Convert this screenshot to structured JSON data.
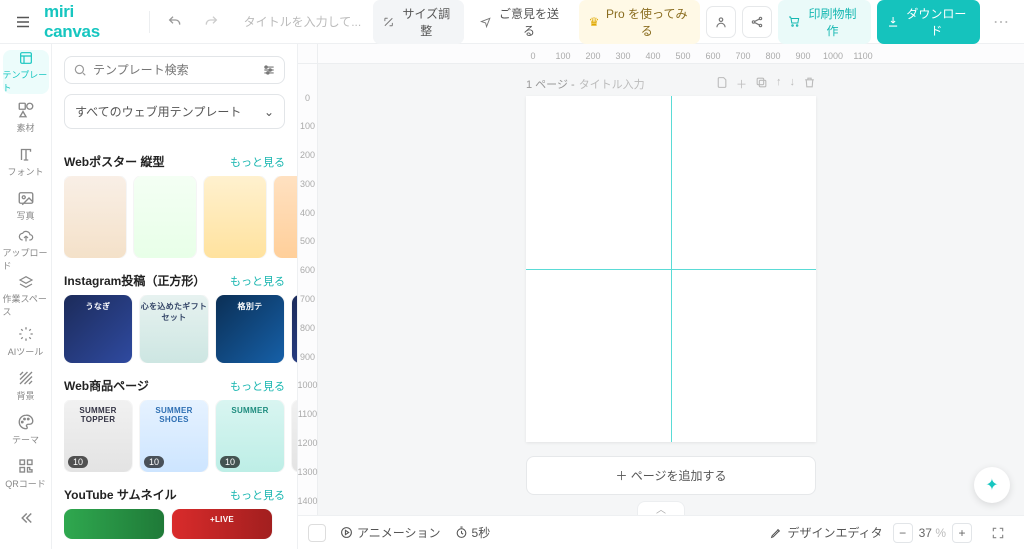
{
  "brand": {
    "name": "miri canvas"
  },
  "top": {
    "title_placeholder": "タイトルを入力して...",
    "resize": "サイズ調整",
    "feedback": "ご意見を送る",
    "pro": "Pro を使ってみる",
    "print": "印刷物制作",
    "download": "ダウンロード"
  },
  "sidenav": {
    "items": [
      {
        "key": "template",
        "label": "テンプレート"
      },
      {
        "key": "elements",
        "label": "素材"
      },
      {
        "key": "font",
        "label": "フォント"
      },
      {
        "key": "photo",
        "label": "写真"
      },
      {
        "key": "upload",
        "label": "アップロード"
      },
      {
        "key": "workspace",
        "label": "作業スペース"
      },
      {
        "key": "ai",
        "label": "AIツール"
      },
      {
        "key": "bg",
        "label": "背景"
      },
      {
        "key": "theme",
        "label": "テーマ"
      },
      {
        "key": "qr",
        "label": "QRコード"
      }
    ]
  },
  "panel": {
    "search_placeholder": "テンプレート検索",
    "filter_label": "すべてのウェブ用テンプレート",
    "more_label": "もっと見る",
    "sections": [
      {
        "title": "Webポスター 縦型"
      },
      {
        "title": "Instagram投稿（正方形）"
      },
      {
        "title": "Web商品ページ"
      },
      {
        "title": "YouTube サムネイル"
      }
    ],
    "badge_count": "10"
  },
  "canvas": {
    "page_label": "1 ページ - ",
    "page_title_placeholder": "タイトル入力",
    "add_page": "＋ ページを追加する",
    "ruler_h": [
      "0",
      "100",
      "200",
      "300",
      "400",
      "500",
      "600",
      "700",
      "800",
      "900",
      "1000",
      "1100"
    ],
    "ruler_v": [
      "0",
      "100",
      "200",
      "300",
      "400",
      "500",
      "600",
      "700",
      "800",
      "900",
      "1000",
      "1100",
      "1200",
      "1300",
      "1400"
    ]
  },
  "bottom": {
    "animation": "アニメーション",
    "duration": "5秒",
    "editor": "デザインエディタ",
    "zoom_value": "37",
    "zoom_unit": "%"
  }
}
